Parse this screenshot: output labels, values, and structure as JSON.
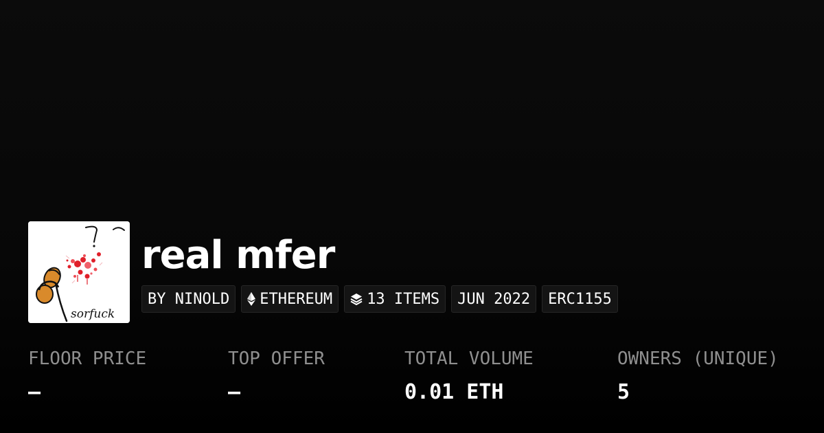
{
  "collection": {
    "name": "real mfer",
    "avatar_icon": "collection-avatar-artwork",
    "avatar_signature": "sorfuck"
  },
  "badges": {
    "creator": "BY NINOLD",
    "chain": "ETHEREUM",
    "chain_icon": "ethereum-icon",
    "items": "13 ITEMS",
    "items_icon": "layers-icon",
    "date": "JUN 2022",
    "standard": "ERC1155"
  },
  "stats": {
    "floor_price": {
      "label": "FLOOR PRICE",
      "value": "—"
    },
    "top_offer": {
      "label": "TOP OFFER",
      "value": "—"
    },
    "total_volume": {
      "label": "TOTAL VOLUME",
      "value": "0.01 ETH"
    },
    "owners": {
      "label": "OWNERS (UNIQUE)",
      "value": "5"
    }
  },
  "colors": {
    "background": "#0b0b0b",
    "badge_background": "#141414",
    "label_gray": "#8f8f8f",
    "text": "#ffffff",
    "accent_red": "#e0202a",
    "accent_orange": "#d98a2b"
  }
}
